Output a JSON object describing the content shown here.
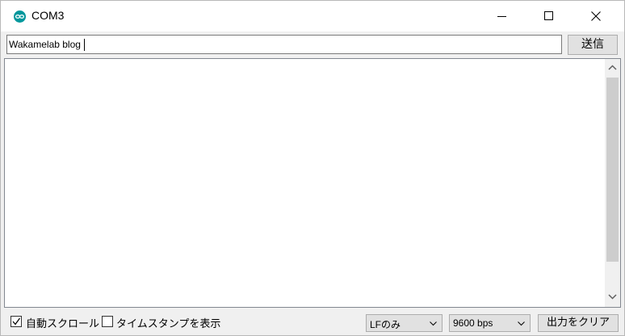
{
  "window": {
    "title": "COM3",
    "icon": "arduino-icon",
    "accent": "#00979c"
  },
  "send_row": {
    "input_value": "Wakamelab blog",
    "send_label": "送信"
  },
  "output": {
    "text": ""
  },
  "bottom_bar": {
    "autoscroll": {
      "label": "自動スクロール",
      "checked": true
    },
    "timestamp": {
      "label": "タイムスタンプを表示",
      "checked": false
    },
    "line_ending": {
      "selected": "LFのみ"
    },
    "baud_rate": {
      "selected": "9600 bps"
    },
    "clear_label": "出力をクリア"
  }
}
